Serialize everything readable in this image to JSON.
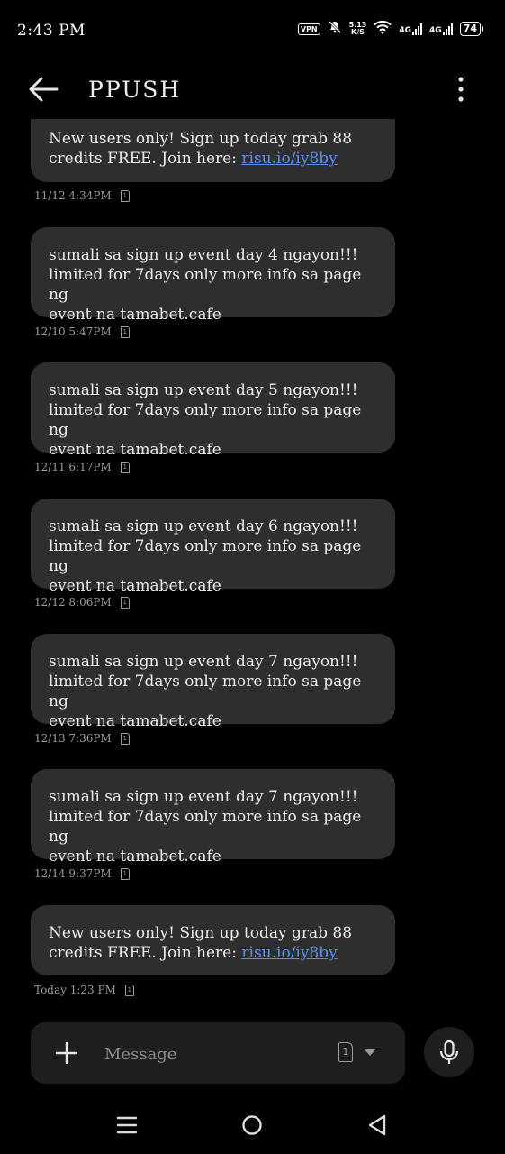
{
  "status": {
    "time": "2:43 PM",
    "vpn": "VPN",
    "speed_value": "5.13",
    "speed_unit": "K/S",
    "net1": "4G",
    "net2": "4G",
    "battery": "74"
  },
  "header": {
    "title": "PPUSH"
  },
  "messages": [
    {
      "line1": "New users only! Sign up today grab 88",
      "line2_prefix": "credits FREE. Join here: ",
      "link": "risu.io/iy8by",
      "time": "11/12 4:34PM",
      "sim": "1"
    },
    {
      "line1": "sumali sa sign up event day 4 ngayon!!!",
      "line2": "limited for 7days only more info sa page ng",
      "line3": "event na tamabet.cafe",
      "time": "12/10 5:47PM",
      "sim": "1"
    },
    {
      "line1": "sumali sa sign up event day 5 ngayon!!!",
      "line2": "limited for 7days only more info sa page ng",
      "line3": "event na tamabet.cafe",
      "time": "12/11 6:17PM",
      "sim": "1"
    },
    {
      "line1": "sumali sa sign up event day 6 ngayon!!!",
      "line2": "limited for 7days only more info sa page ng",
      "line3": "event na tamabet.cafe",
      "time": "12/12 8:06PM",
      "sim": "1"
    },
    {
      "line1": "sumali sa sign up event day 7 ngayon!!!",
      "line2": "limited for 7days only more info sa page ng",
      "line3": "event na tamabet.cafe",
      "time": "12/13 7:36PM",
      "sim": "1"
    },
    {
      "line1": "sumali sa sign up event day 7 ngayon!!!",
      "line2": "limited for 7days only more info sa page ng",
      "line3": "event na tamabet.cafe",
      "time": "12/14 9:37PM",
      "sim": "1"
    },
    {
      "line1": "New users only! Sign up today grab 88",
      "line2_prefix": "credits FREE. Join here: ",
      "link": "risu.io/iy8by",
      "time": "Today 1:23 PM",
      "sim": "1"
    }
  ],
  "composer": {
    "placeholder": "Message",
    "sim": "1"
  },
  "icons": {
    "back": "arrow-left-icon",
    "more": "more-vert-icon",
    "attach": "plus-icon",
    "sim": "sim-card-icon",
    "dropdown": "chevron-down-icon",
    "mic": "mic-icon",
    "nav_menu": "menu-icon",
    "nav_home": "home-circle-icon",
    "nav_back": "back-triangle-icon"
  },
  "colors": {
    "background": "#000000",
    "bubble": "#2e2e2e",
    "link": "#5b8ff0",
    "meta": "#9a9a9a"
  }
}
